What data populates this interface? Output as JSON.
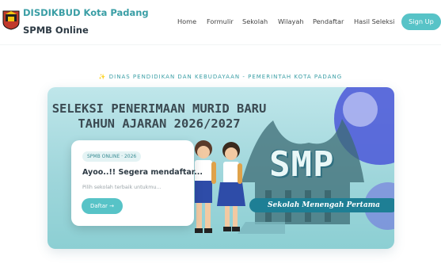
{
  "header": {
    "brand_line1": "DISDIKBUD Kota Padang",
    "brand_line2": "SPMB Online",
    "nav": [
      "Home",
      "Formulir",
      "Sekolah",
      "Wilayah",
      "Pendaftar",
      "Hasil Seleksi"
    ],
    "signup_label": "Sign Up"
  },
  "hero": {
    "tagline_icon": "sparkles-icon",
    "tagline": "DINAS PENDIDIKAN DAN KEBUDAYAAN - PEMERINTAH KOTA PADANG"
  },
  "banner": {
    "title_line1": "SELEKSI PENERIMAAN MURID BARU",
    "title_line2": "TAHUN AJARAN 2026/2027",
    "level": "SMP",
    "level_subtitle": "Sekolah Menengah Pertama",
    "card": {
      "badge": "SPMB ONLINE · 2026",
      "title": "Ayoo..!! Segera mendaftar...",
      "description": "Pilih sekolah terbaik untukmu...",
      "button_label": "Daftar →"
    }
  },
  "colors": {
    "accent": "#57c3c7",
    "brand": "#3a9ea5",
    "dark": "#2d3a44"
  }
}
